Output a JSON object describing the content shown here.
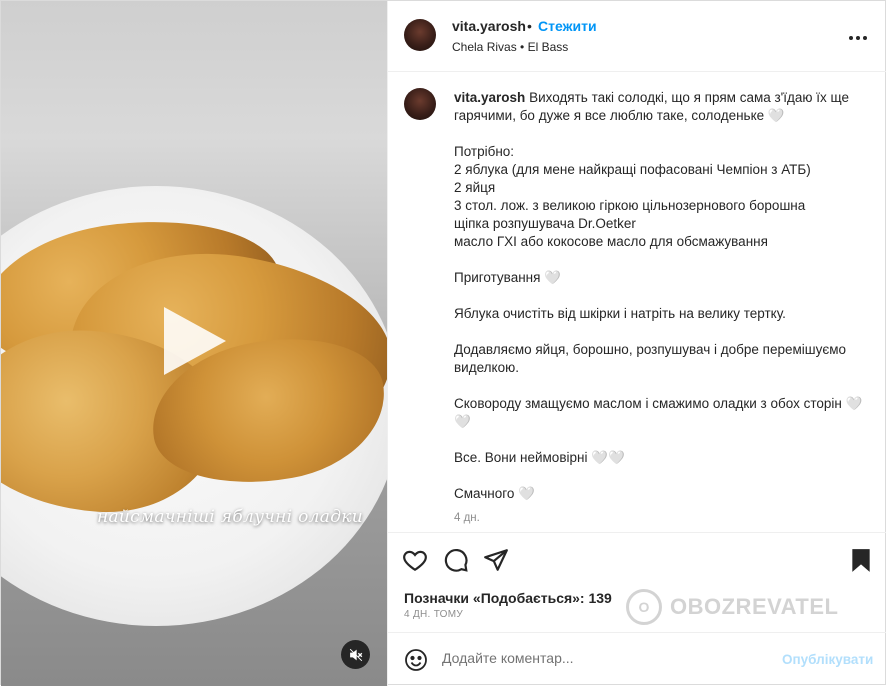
{
  "media": {
    "overlay_text": "найсмачніші яблучні оладки"
  },
  "header": {
    "username": "vita.yarosh",
    "dot": "•",
    "follow_label": "Стежити",
    "music": "Chela Rivas • El Bass"
  },
  "post": {
    "username": "vita.yarosh",
    "caption": "Виходять такі солодкі, що я прям сама з'їдаю їх ще гарячими, бо дуже я все люблю таке, солоденьке 🤍\n\nПотрібно:\n2 яблука (для мене найкращі пофасовані Чемпіон з АТБ)\n2 яйця\n3 стол. лож. з великою гіркою цільнозернового борошна\nщіпка розпушувача Dr.Oetker\nмасло ГХІ або кокосове масло для обсмажування\n\nПриготування 🤍\n\nЯблука очистіть від шкірки і натріть на велику тертку.\n\nДодавляємо яйця, борошно, розпушувач і добре перемішуємо виделкою.\n\nСковороду змащуємо маслом і смажимо оладки з обох сторін 🤍🤍\n\nВсе. Вони неймовірні 🤍🤍\n\nСмачного 🤍",
    "time": "4 дн."
  },
  "actions": {
    "likes": "Позначки «Подобається»: 139",
    "ago": "4 ДН. ТОМУ"
  },
  "watermark": {
    "logo": "O",
    "text": "OBOZREVATEL"
  },
  "comment": {
    "placeholder": "Додайте коментар...",
    "publish": "Опублікувати"
  },
  "icons": [
    "heart-icon",
    "comment-icon",
    "share-icon",
    "bookmark-icon",
    "emoji-icon",
    "mute-icon",
    "more-icon"
  ]
}
